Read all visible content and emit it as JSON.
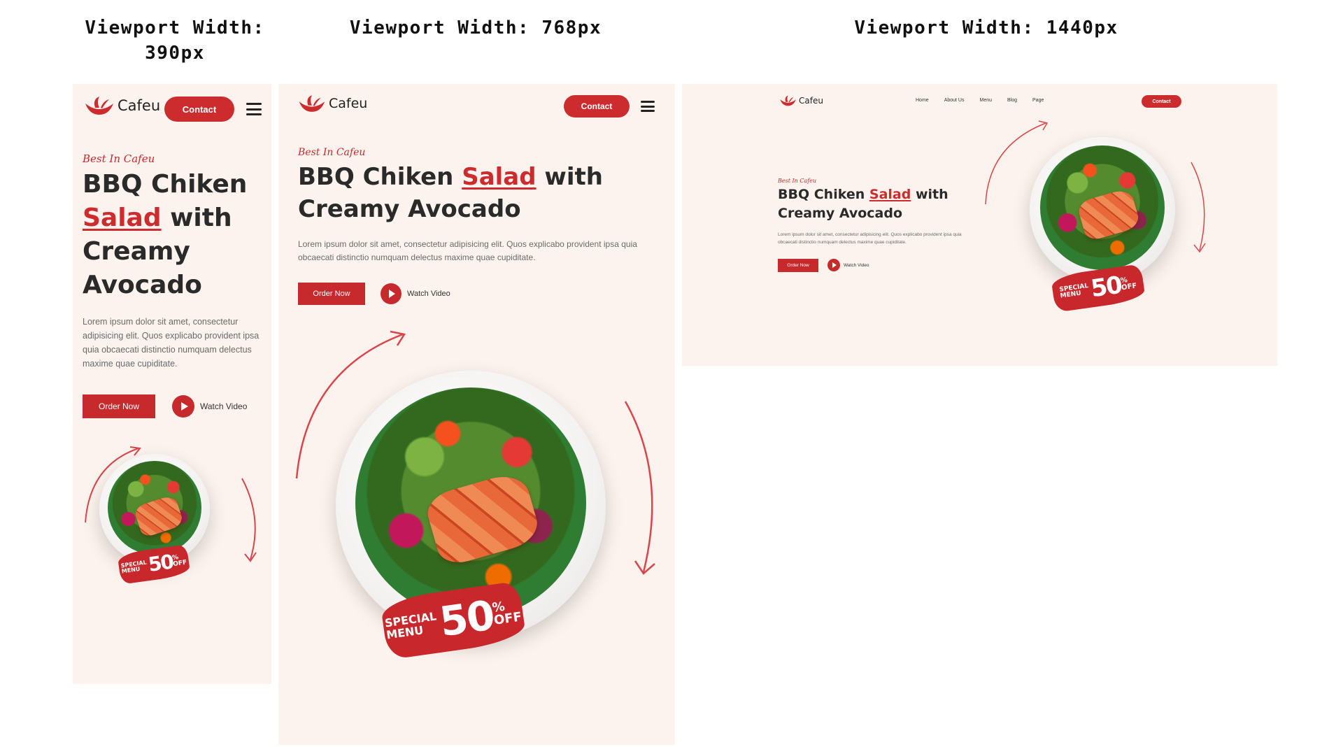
{
  "labels": {
    "mobile": "Viewport Width: 390px",
    "tablet": "Viewport Width: 768px",
    "desktop": "Viewport Width: 1440px"
  },
  "brand": {
    "name": "Cafeu",
    "color": "#cd2c2f",
    "background": "#fcf3ee"
  },
  "nav": [
    "Home",
    "About Us",
    "Menu",
    "Blog",
    "Page"
  ],
  "contact_label": "Contact",
  "hero": {
    "eyebrow": "Best In Cafeu",
    "title_before": "BBQ Chiken",
    "title_accent": "Salad",
    "title_after": "with",
    "title_line2": "Creamy Avocado",
    "description": "Lorem ipsum dolor sit amet, consectetur adipisicing elit. Quos explicabo provident ipsa quia obcaecati distinctio numquam delectus maxime quae cupiditate.",
    "order_label": "Order Now",
    "watch_label": "Watch Video"
  },
  "badge": {
    "line1": "SPECIAL",
    "line2": "MENU",
    "value": "50",
    "percent": "%",
    "off": "OFF"
  },
  "icons": [
    "cafeu-logo-icon",
    "hamburger-menu-icon",
    "play-icon",
    "curved-arrow-icon"
  ]
}
